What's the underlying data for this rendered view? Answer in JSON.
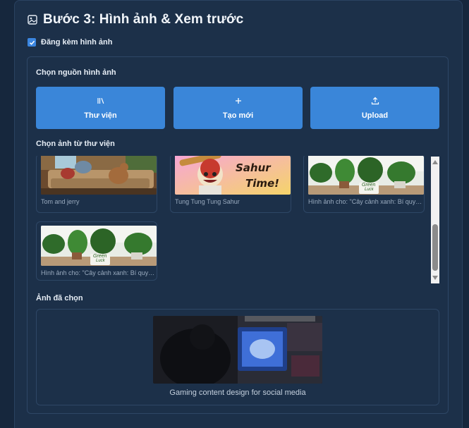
{
  "step": {
    "title": "Bước 3: Hình ảnh & Xem trước",
    "icon": "image-icon"
  },
  "attach": {
    "label": "Đăng kèm hình ảnh",
    "checked": true
  },
  "source": {
    "label": "Chọn nguồn hình ảnh",
    "buttons": [
      {
        "label": "Thư viện",
        "icon": "library-icon"
      },
      {
        "label": "Tạo mới",
        "icon": "plus-icon"
      },
      {
        "label": "Upload",
        "icon": "upload-icon"
      }
    ]
  },
  "library": {
    "label": "Chọn ảnh từ thư viện",
    "items": [
      {
        "caption": "Tom and jerry"
      },
      {
        "caption": "Tung Tung Tung Sahur"
      },
      {
        "caption": "Hình ảnh cho: \"Cây cảnh xanh: Bí quyết chăm sóc\""
      },
      {
        "caption": "Hình ảnh cho: \"Cây cảnh xanh: Bí quyết chăm sóc\""
      }
    ],
    "sahur_text_1": "Sahur",
    "sahur_text_2": "Time!",
    "plant_logo_1": "Green",
    "plant_logo_2": "Luck"
  },
  "selected": {
    "label": "Ảnh đã chọn",
    "caption": "Gaming content design for social media"
  },
  "colors": {
    "accent": "#3a86d9",
    "background": "#16273d",
    "card": "#1c3049"
  }
}
